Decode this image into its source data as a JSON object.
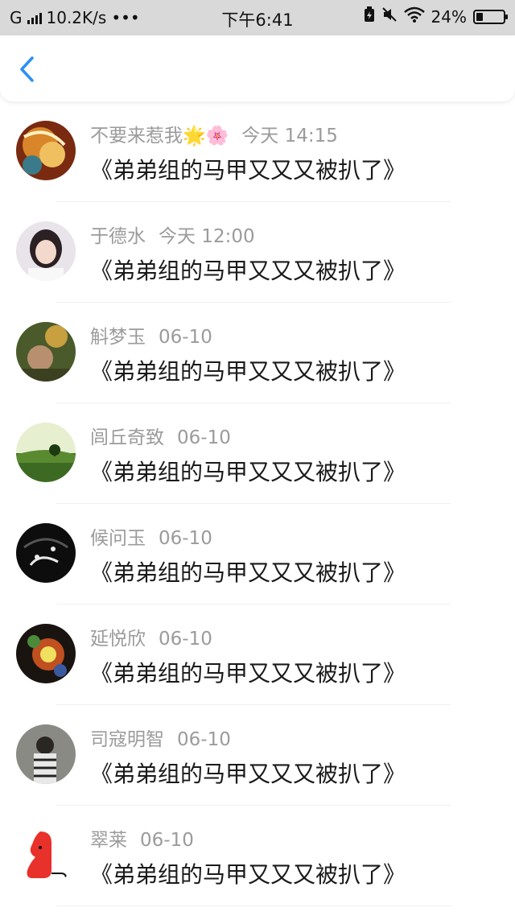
{
  "status_bar": {
    "carrier": "G",
    "net_speed": "10.2K/s",
    "more": "•••",
    "time": "下午6:41",
    "battery": "24%",
    "battery_level": 0.24
  },
  "nav": {
    "back_icon": "chevron-left-icon",
    "accent_color": "#2a8ff7"
  },
  "comments": [
    {
      "name": "不要来惹我🌟🌸",
      "time": "今天 14:15",
      "text": "《弟弟组的马甲又又又被扒了》"
    },
    {
      "name": "于德水",
      "time": "今天 12:00",
      "text": "《弟弟组的马甲又又又被扒了》"
    },
    {
      "name": "斛梦玉",
      "time": "06-10",
      "text": "《弟弟组的马甲又又又被扒了》"
    },
    {
      "name": "闾丘奇致",
      "time": "06-10",
      "text": "《弟弟组的马甲又又又被扒了》"
    },
    {
      "name": "候问玉",
      "time": "06-10",
      "text": "《弟弟组的马甲又又又被扒了》"
    },
    {
      "name": "延悦欣",
      "time": "06-10",
      "text": "《弟弟组的马甲又又又被扒了》"
    },
    {
      "name": "司寇明智",
      "time": "06-10",
      "text": "《弟弟组的马甲又又又被扒了》"
    },
    {
      "name": "翠莱",
      "time": "06-10",
      "text": "《弟弟组的马甲又又又被扒了》"
    }
  ]
}
